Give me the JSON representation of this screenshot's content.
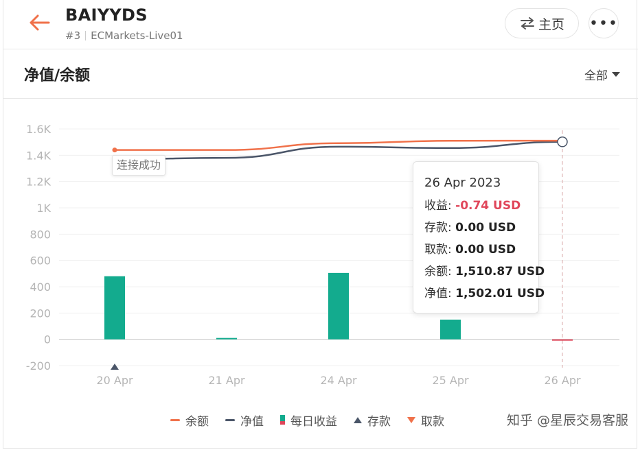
{
  "header": {
    "title": "BAIYYDS",
    "account_no": "#3",
    "server": "ECMarkets-Live01",
    "home_label": "主页",
    "more_label": "•••"
  },
  "section": {
    "title": "净值/余额",
    "filter_label": "全部"
  },
  "chart_data": {
    "type": "bar+line",
    "categories": [
      "20 Apr",
      "21 Apr",
      "24 Apr",
      "25 Apr",
      "26 Apr"
    ],
    "y_ticks": [
      "1.6K",
      "1.4K",
      "1.2K",
      "1K",
      "800",
      "600",
      "400",
      "200",
      "0",
      "-200"
    ],
    "ylim": [
      -200,
      1600
    ],
    "grid": true,
    "series": [
      {
        "name": "余额",
        "type": "line",
        "color": "#f0714a",
        "values": [
          1440,
          1440,
          1492,
          1510,
          1510.87
        ]
      },
      {
        "name": "净值",
        "type": "line",
        "color": "#4a5568",
        "values": [
          1370,
          1380,
          1465,
          1455,
          1502.01
        ]
      },
      {
        "name": "每日收益",
        "type": "bar",
        "color": "#13ab8e",
        "negative_color": "#e0465a",
        "values": [
          480,
          10,
          505,
          150,
          -0.74
        ]
      },
      {
        "name": "存款",
        "type": "marker",
        "color": "#4a5568",
        "markers": [
          "20 Apr"
        ]
      },
      {
        "name": "取款",
        "type": "marker",
        "color": "#f0714a",
        "markers": []
      }
    ],
    "annotations": [
      {
        "category": "20 Apr",
        "text": "连接成功"
      }
    ],
    "legend_position": "bottom"
  },
  "tooltip": {
    "date": "26 Apr 2023",
    "profit_label": "收益:",
    "profit_value": "-0.74 USD",
    "deposit_label": "存款:",
    "deposit_value": "0.00 USD",
    "withdraw_label": "取款:",
    "withdraw_value": "0.00 USD",
    "balance_label": "余额:",
    "balance_value": "1,510.87 USD",
    "equity_label": "净值:",
    "equity_value": "1,502.01 USD"
  },
  "watermark": "知乎 @星辰交易客服"
}
